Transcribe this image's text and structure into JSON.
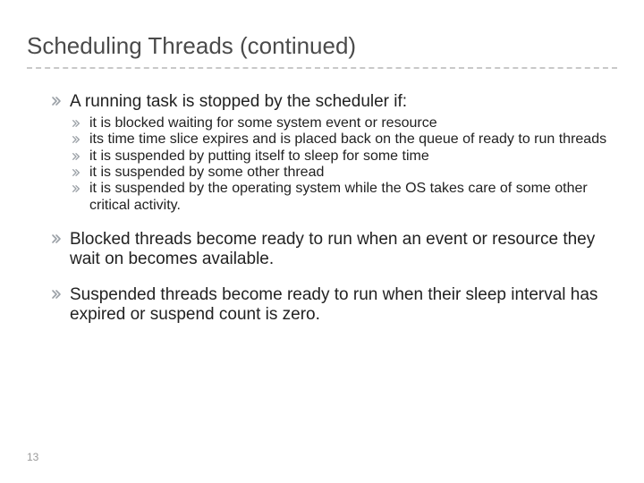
{
  "slide": {
    "title": "Scheduling Threads (continued)",
    "page_number": "13",
    "points": [
      {
        "text": "A running task is stopped by the scheduler if:",
        "sub": [
          "it is blocked waiting for some system event or resource",
          "its time time slice expires and is placed back on the queue of ready to run threads",
          "it is suspended by putting itself to sleep for some time",
          "it is suspended by some other thread",
          "it is suspended by the operating system while the OS takes care of some other critical activity."
        ]
      },
      {
        "text": "Blocked threads become ready to run when an event or resource they wait on becomes available.",
        "sub": []
      },
      {
        "text": "Suspended threads become ready to run when their sleep interval has expired or suspend count is zero.",
        "sub": []
      }
    ]
  }
}
